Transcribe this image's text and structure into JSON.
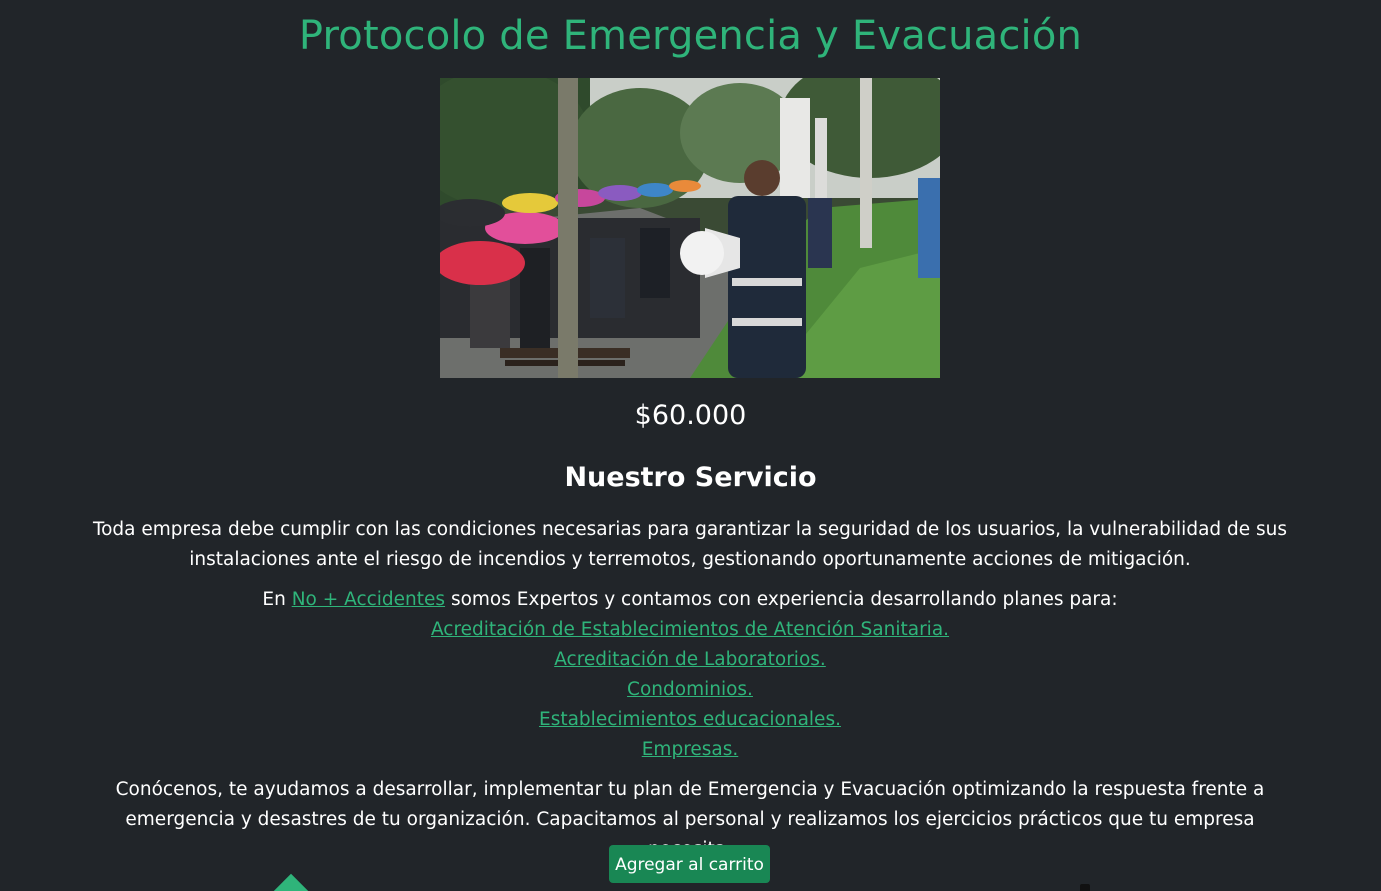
{
  "header": {
    "title": "Protocolo de Emergencia y Evacuación"
  },
  "product": {
    "price": "$60.000"
  },
  "service": {
    "heading": "Nuestro Servicio",
    "intro": "Toda empresa debe cumplir con las condiciones necesarias para garantizar la seguridad de los usuarios, la vulnerabilidad de sus instalaciones ante el riesgo de incendios y terremotos, gestionando oportunamente acciones de mitigación.",
    "experience_prefix": "En",
    "brand_link": "No + Accidentes",
    "experience_suffix": "somos Expertos y contamos con experiencia desarrollando planes para:",
    "plans": [
      "Acreditación de Establecimientos de Atención Sanitaria.",
      "Acreditación de Laboratorios.",
      "Condominios.",
      "Establecimientos educacionales.",
      "Empresas."
    ],
    "closing": "Conócenos, te ayudamos a desarrollar, implementar tu plan de Emergencia y Evacuación optimizando la respuesta frente a emergencia y desastres de tu organización. Capacitamos al personal y realizamos los ejercicios prácticos que tu empresa necesita."
  },
  "actions": {
    "add_to_cart": "Agregar al carrito"
  },
  "colors": {
    "background": "#212529",
    "accent": "#2fb47a",
    "button": "#198754",
    "text": "#ffffff"
  }
}
